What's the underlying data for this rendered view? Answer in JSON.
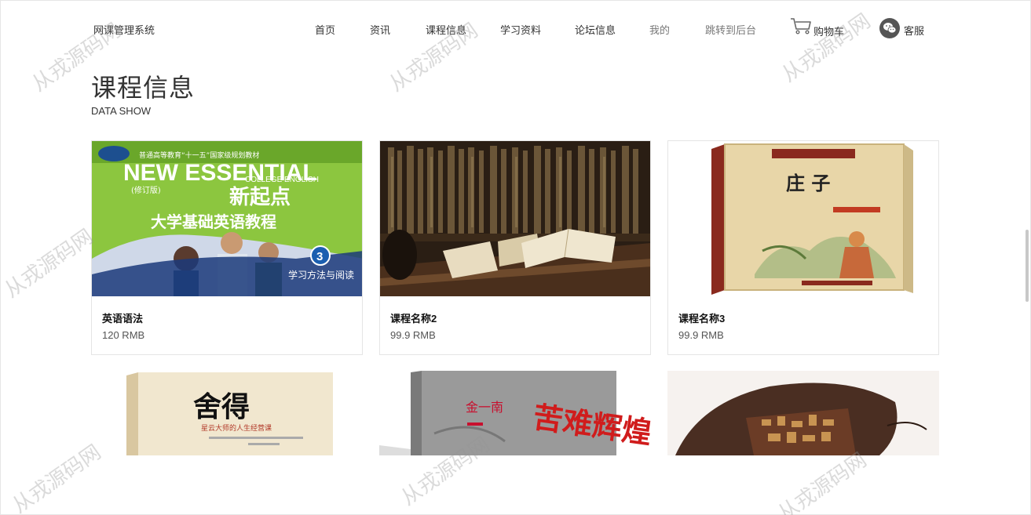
{
  "brand": "网课管理系统",
  "nav": [
    {
      "label": "首页"
    },
    {
      "label": "资讯"
    },
    {
      "label": "课程信息"
    },
    {
      "label": "学习资料"
    },
    {
      "label": "论坛信息"
    },
    {
      "label": "我的"
    },
    {
      "label": "跳转到后台"
    }
  ],
  "cart": {
    "label": "购物车",
    "icon": "cart-icon"
  },
  "service": {
    "label": "客服",
    "icon": "wechat-icon"
  },
  "section": {
    "title": "课程信息",
    "subtitle": "DATA SHOW"
  },
  "courses": [
    {
      "name": "英语语法",
      "price": "120 RMB",
      "cover": {
        "top_text": "普通高等教育“十一五”国家级规划教材",
        "title_en": "NEW ESSENTIAL",
        "title_en2": "COLLEGE ENGLISH",
        "edition": "(修订版)",
        "title_cn": "新起点",
        "subtitle_cn": "大学基础英语教程",
        "volume": "3",
        "volume_label": "学习方法与阅读"
      }
    },
    {
      "name": "课程名称2",
      "price": "99.9 RMB"
    },
    {
      "name": "课程名称3",
      "price": "99.9 RMB",
      "cover": {
        "title_cn": "庄 子"
      }
    }
  ],
  "more_courses": [
    {
      "cover": {
        "title_cn": "舍得",
        "subtitle_cn": "星云大师的人生经营课"
      }
    },
    {
      "cover": {
        "title_cn": "苦难辉煌",
        "author": "金一南"
      }
    },
    {
      "cover": {}
    }
  ],
  "watermark": "从戎源码网",
  "colors": {
    "accent": "#8bc34a",
    "text": "#333333",
    "border": "#e5e5e5"
  }
}
